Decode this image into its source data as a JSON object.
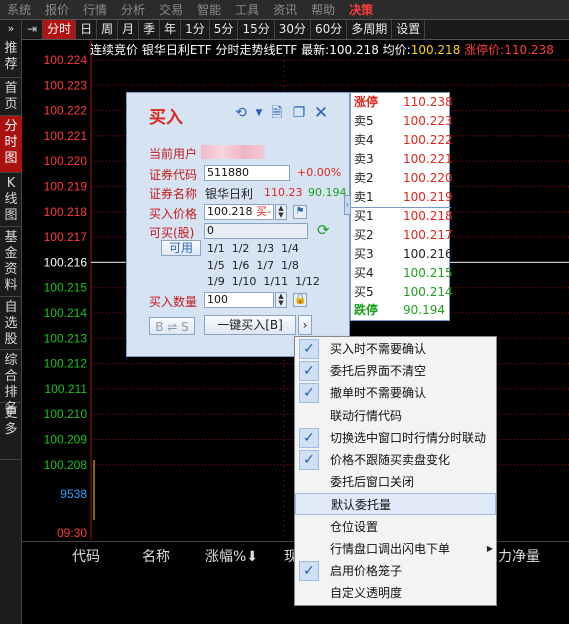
{
  "menu": [
    "系统",
    "报价",
    "行情",
    "分析",
    "交易",
    "智能",
    "工具",
    "资讯",
    "帮助",
    "决策"
  ],
  "menu_active_index": 9,
  "left_nav": {
    "top_label": "推荐",
    "items": [
      {
        "label": "首页"
      },
      {
        "label": "分时图"
      },
      {
        "label": "K线图"
      },
      {
        "label": "基金资料"
      },
      {
        "label": "自选股"
      },
      {
        "label": "综合排名"
      },
      {
        "label": "更多"
      }
    ]
  },
  "tabs": [
    "分时",
    "日",
    "周",
    "月",
    "季",
    "年",
    "1分",
    "5分",
    "15分",
    "30分",
    "60分",
    "多周期",
    "设置"
  ],
  "tab_active_index": 0,
  "chart_header": {
    "prefix": "连续竞价",
    "name": "银华日利ETF",
    "title": "分时走势线ETF",
    "last_label": "最新:",
    "last_value": "100.218",
    "avg_label": "均价:",
    "avg_value": "100.218",
    "limit_label": "涨停价:",
    "limit_value": "110.238"
  },
  "chart_data": {
    "type": "line",
    "y_tick_labels": [
      "100.224",
      "100.223",
      "100.222",
      "100.221",
      "100.220",
      "100.219",
      "100.218",
      "100.217",
      "100.216",
      "100.215",
      "100.214",
      "100.213",
      "100.212",
      "100.211",
      "100.210",
      "100.209",
      "100.208"
    ],
    "ylim": [
      100.208,
      100.224
    ],
    "reference_price": "100.216",
    "volume_label": "9538",
    "x_tick_labels": [
      "09:30"
    ],
    "grid": true
  },
  "table_header": [
    "代码",
    "名称",
    "涨幅%",
    "现",
    "力净量"
  ],
  "buy_dialog": {
    "title": "买入",
    "user_label": "当前用户",
    "code_label": "证券代码",
    "code_value": "511880",
    "code_change": "+0.00%",
    "name_label": "证券名称",
    "name_value": "银华日利",
    "name_price_red": "110.23",
    "name_price_green": "90.194",
    "price_label": "买入价格",
    "price_value": "100.218",
    "price_suffix": "买-",
    "can_buy_label": "可买(股)",
    "can_buy_value": "0",
    "available_label": "可用",
    "fractions_row1": [
      "1/1",
      "1/2",
      "1/3",
      "1/4"
    ],
    "fractions_row2": [
      "1/5",
      "1/6",
      "1/7",
      "1/8"
    ],
    "fractions_row3": [
      "1/9",
      "1/10",
      "1/11",
      "1/12"
    ],
    "qty_label": "买入数量",
    "qty_value": "100",
    "switch_button": "B ⇌ S",
    "buy_button": "一键买入[B]",
    "more_button": "›",
    "icons": [
      "undo-icon",
      "dropdown-icon",
      "query-icon",
      "copy-icon",
      "close-icon"
    ]
  },
  "order_book": {
    "limit_up_label": "涨停",
    "limit_up_value": "110.238",
    "asks": [
      {
        "label": "卖5",
        "price": "100.223"
      },
      {
        "label": "卖4",
        "price": "100.222"
      },
      {
        "label": "卖3",
        "price": "100.221"
      },
      {
        "label": "卖2",
        "price": "100.220"
      },
      {
        "label": "卖1",
        "price": "100.219"
      }
    ],
    "bids": [
      {
        "label": "买1",
        "price": "100.218"
      },
      {
        "label": "买2",
        "price": "100.217"
      },
      {
        "label": "买3",
        "price": "100.216"
      },
      {
        "label": "买4",
        "price": "100.215"
      },
      {
        "label": "买5",
        "price": "100.214"
      }
    ],
    "limit_down_label": "跌停",
    "limit_down_value": "90.194"
  },
  "context_menu": [
    {
      "label": "买入时不需要确认",
      "checked": true
    },
    {
      "label": "委托后界面不清空",
      "checked": true
    },
    {
      "label": "撤单时不需要确认",
      "checked": true
    },
    {
      "label": "联动行情代码",
      "checked": false
    },
    {
      "label": "切换选中窗口时行情分时联动",
      "checked": true
    },
    {
      "label": "价格不跟随买卖盘变化",
      "checked": true
    },
    {
      "label": "委托后窗口关闭",
      "checked": false
    },
    {
      "label": "默认委托量",
      "checked": false,
      "highlighted": true
    },
    {
      "label": "仓位设置",
      "checked": false
    },
    {
      "label": "行情盘口调出闪电下单",
      "checked": false,
      "submenu": true
    },
    {
      "label": "启用价格笼子",
      "checked": true
    },
    {
      "label": "自定义透明度",
      "checked": false
    }
  ],
  "colors": {
    "up": "#ff3b3b",
    "down": "#20c020",
    "neutral": "#ffffff",
    "accent": "#b21414"
  }
}
